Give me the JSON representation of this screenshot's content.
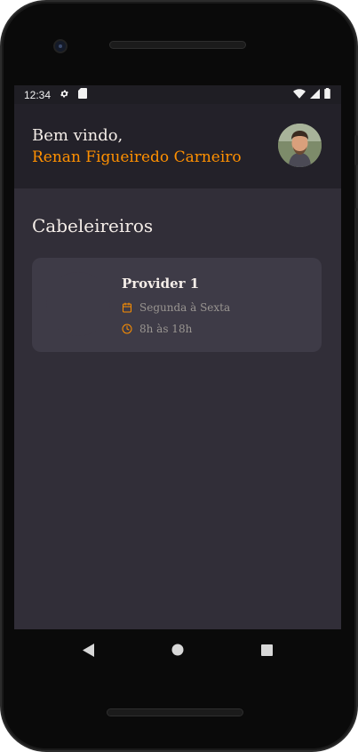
{
  "status_bar": {
    "time": "12:34",
    "icons": [
      "gear-icon",
      "sd-card-icon",
      "wifi-icon",
      "signal-icon",
      "battery-icon"
    ]
  },
  "header": {
    "greeting": "Bem vindo,",
    "user_name": "Renan Figueiredo Carneiro",
    "avatar_icon": "user-avatar"
  },
  "main": {
    "section_title": "Cabeleireiros",
    "providers": [
      {
        "name": "Provider 1",
        "days": "Segunda à Sexta",
        "hours": "8h às 18h",
        "days_icon": "calendar-icon",
        "hours_icon": "clock-icon"
      }
    ]
  },
  "nav_bar": {
    "buttons": [
      "back-icon",
      "home-icon",
      "recents-icon"
    ]
  },
  "colors": {
    "accent": "#ff9000",
    "background": "#312e38",
    "header_bg": "#232129",
    "card_bg": "#3e3b47",
    "text_primary": "#f4ede8",
    "text_secondary": "#999591"
  }
}
